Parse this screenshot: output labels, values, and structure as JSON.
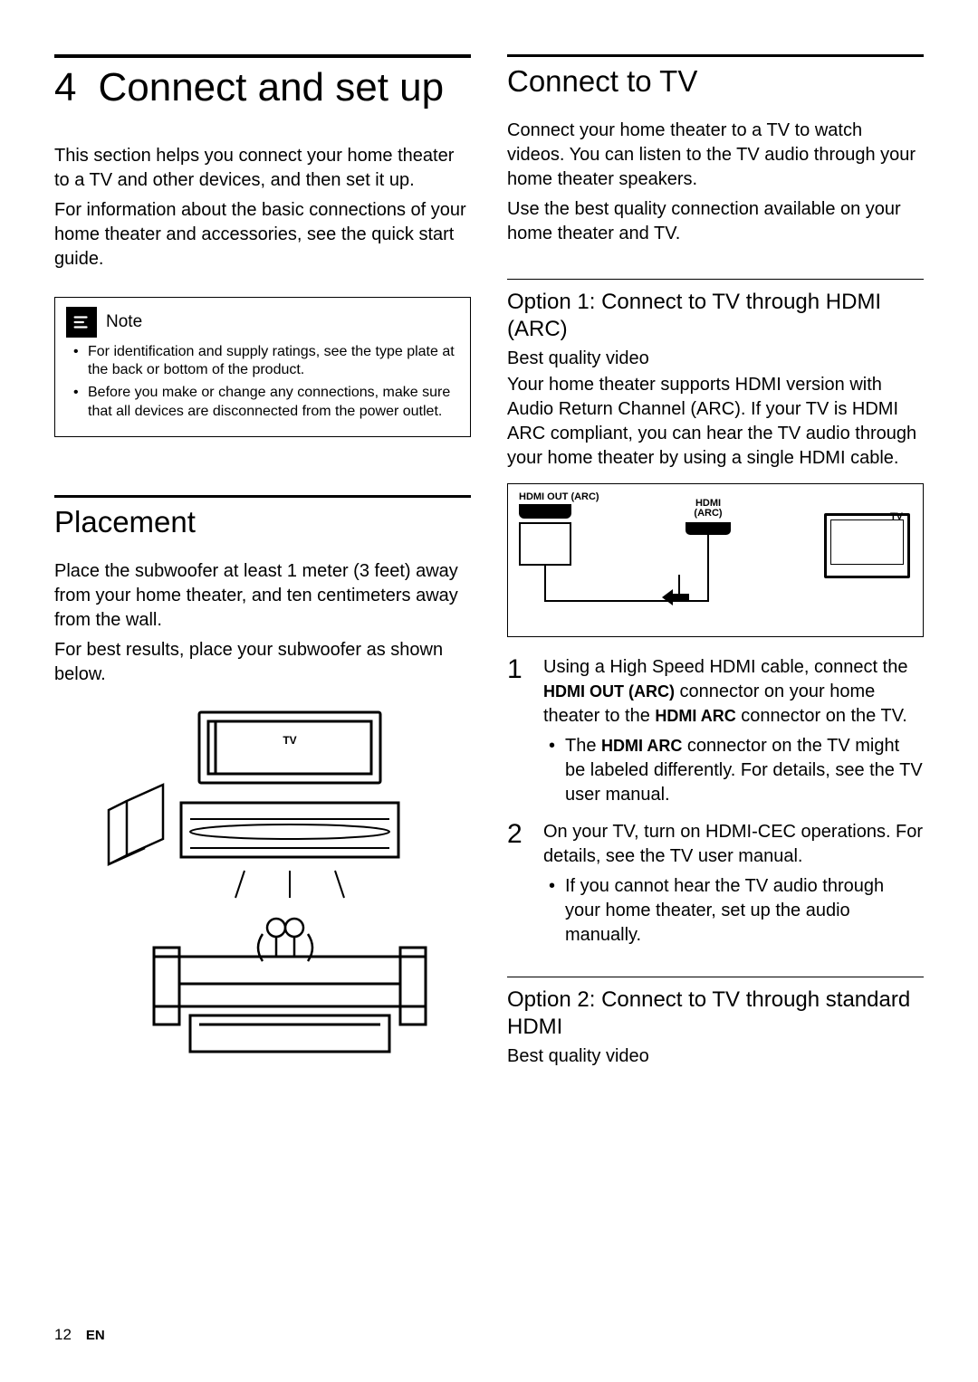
{
  "chapter": {
    "number": "4",
    "title": "Connect and set up"
  },
  "left": {
    "intro1": "This section helps you connect your home theater to a TV and other devices, and then set it up.",
    "intro2": "For information about the basic connections of your home theater and accessories, see the quick start guide.",
    "note": {
      "title": "Note",
      "items": [
        "For identification and supply ratings, see the type plate at the back or bottom of the product.",
        "Before you make or change any connections, make sure that all devices are disconnected from the power outlet."
      ]
    },
    "placement": {
      "heading": "Placement",
      "p1": "Place the subwoofer at least 1 meter (3 feet) away from your home theater, and ten centimeters away from the wall.",
      "p2": "For best results, place your subwoofer as shown below.",
      "tv_label": "TV"
    }
  },
  "right": {
    "heading": "Connect to TV",
    "p1": "Connect your home theater to a TV to watch videos. You can listen to the TV audio through your home theater speakers.",
    "p2": "Use the best quality connection available on your home theater and TV.",
    "option1": {
      "heading": "Option 1: Connect to TV through HDMI (ARC)",
      "sub": "Best quality video",
      "desc": "Your home theater supports HDMI version with Audio Return Channel (ARC). If your TV is HDMI ARC compliant, you can hear the TV audio through your home theater by using a single HDMI cable.",
      "diagram": {
        "hdmi_out": "HDMI OUT (ARC)",
        "hdmi_arc": "HDMI (ARC)",
        "tv": "TV"
      },
      "steps": [
        {
          "num": "1",
          "text_a": "Using a High Speed HDMI cable, connect the ",
          "bold_a": "HDMI OUT (ARC)",
          "text_b": " connector on your home theater to the ",
          "bold_b": "HDMI ARC",
          "text_c": " connector on the TV.",
          "bullet_a": "The ",
          "bullet_bold": "HDMI ARC",
          "bullet_b": " connector on the TV might be labeled differently. For details, see the TV user manual."
        },
        {
          "num": "2",
          "text": "On your TV, turn on HDMI-CEC operations. For details, see the TV user manual.",
          "bullet": "If you cannot hear the TV audio through your home theater, set up the audio manually."
        }
      ]
    },
    "option2": {
      "heading": "Option 2: Connect to TV through standard HDMI",
      "sub": "Best quality video"
    }
  },
  "footer": {
    "page": "12",
    "lang": "EN"
  }
}
